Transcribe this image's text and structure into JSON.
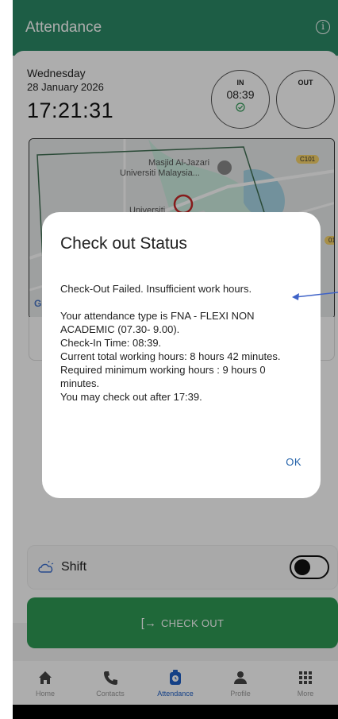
{
  "header": {
    "title": "Attendance",
    "info_icon": "info-icon",
    "color": "#2c8a66"
  },
  "date": {
    "day": "Wednesday",
    "date": "28 January 2026",
    "time": "17:21:31"
  },
  "clock": {
    "in": {
      "label": "IN",
      "time": "08:39",
      "icon": "check-circle-icon"
    },
    "out": {
      "label": "OUT"
    }
  },
  "map": {
    "labels": [
      "Masjid Al-Jazari",
      "Universiti Malaysia...",
      "Universiti"
    ],
    "road_tag": "C101",
    "road_tag_2": "01",
    "attribution": "G"
  },
  "dialog": {
    "title": "Check out Status",
    "line1": "Check-Out Failed. Insufficient work hours.",
    "line2": "Your attendance type is  FNA - FLEXI NON ACADEMIC (07.30- 9.00).",
    "line3": "Check-In Time: 08:39.",
    "line4": "Current total working hours: 8 hours 42 minutes.",
    "line5": "Required minimum working hours : 9 hours 0 minutes.",
    "line6": "You may check out after 17:39.",
    "ok_label": "OK"
  },
  "shift": {
    "label": "Shift",
    "toggle_on": false
  },
  "checkout": {
    "label": "CHECK OUT",
    "color": "#2e9a55"
  },
  "nav": {
    "items": [
      {
        "label": "Home",
        "icon": "home-icon"
      },
      {
        "label": "Contacts",
        "icon": "phone-icon"
      },
      {
        "label": "Attendance",
        "icon": "attendance-clock-icon",
        "active": true
      },
      {
        "label": "Profile",
        "icon": "person-icon"
      },
      {
        "label": "More",
        "icon": "grid-icon"
      }
    ],
    "active_color": "#1e5fc6"
  }
}
